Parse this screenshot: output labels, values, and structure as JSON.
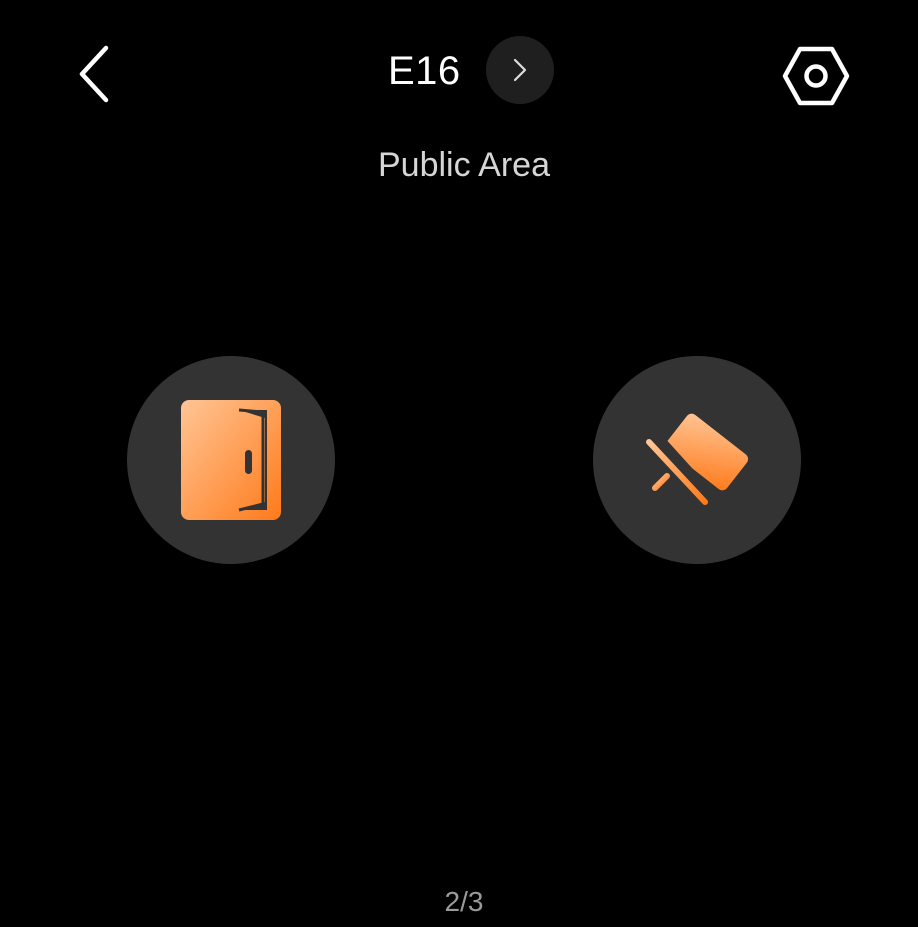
{
  "header": {
    "back_icon": "chevron-left-icon",
    "device_name": "E16",
    "next_icon": "chevron-right-icon",
    "settings_icon": "hexagon-settings-icon"
  },
  "location": {
    "name": "Public Area"
  },
  "actions": [
    {
      "id": "unlock",
      "icon": "door-icon"
    },
    {
      "id": "monitor",
      "icon": "cctv-camera-icon"
    }
  ],
  "pagination": {
    "text": "2/3"
  },
  "colors": {
    "background": "#000000",
    "button_bg": "#333333",
    "accent_light": "#ffb57a",
    "accent_dark": "#ff7a1a"
  }
}
